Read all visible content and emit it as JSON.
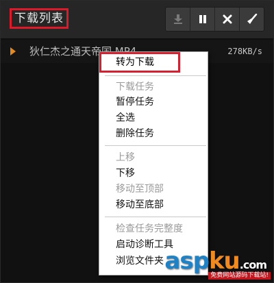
{
  "header": {
    "title": "下载列表",
    "title_box_color": "#e0192a",
    "toolbar": [
      {
        "name": "download-icon"
      },
      {
        "name": "pause-icon"
      },
      {
        "name": "close-icon"
      },
      {
        "name": "broom-icon"
      }
    ]
  },
  "download": {
    "file_name": "狄仁杰之通天帝国.MP4",
    "speed": "278KB/s",
    "play_color": "#e2891f"
  },
  "context_menu": {
    "highlight_color": "#d62030",
    "items": [
      {
        "label": "转为下载",
        "enabled": true,
        "highlighted": true
      },
      {
        "label": "下载任务",
        "enabled": false
      },
      {
        "label": "暂停任务",
        "enabled": true
      },
      {
        "label": "全选",
        "enabled": true
      },
      {
        "label": "删除任务",
        "enabled": true
      },
      {
        "label": "上移",
        "enabled": false
      },
      {
        "label": "下移",
        "enabled": true
      },
      {
        "label": "移动至顶部",
        "enabled": false
      },
      {
        "label": "移动至底部",
        "enabled": true
      },
      {
        "label": "检查任务完整度",
        "enabled": false
      },
      {
        "label": "启动诊断工具",
        "enabled": true
      },
      {
        "label": "浏览文件夹",
        "enabled": true
      }
    ]
  },
  "watermark": {
    "logo_a": "asp",
    "logo_b": "ku",
    "logo_c": ".com",
    "tagline": "免费网站源码下载站!"
  }
}
